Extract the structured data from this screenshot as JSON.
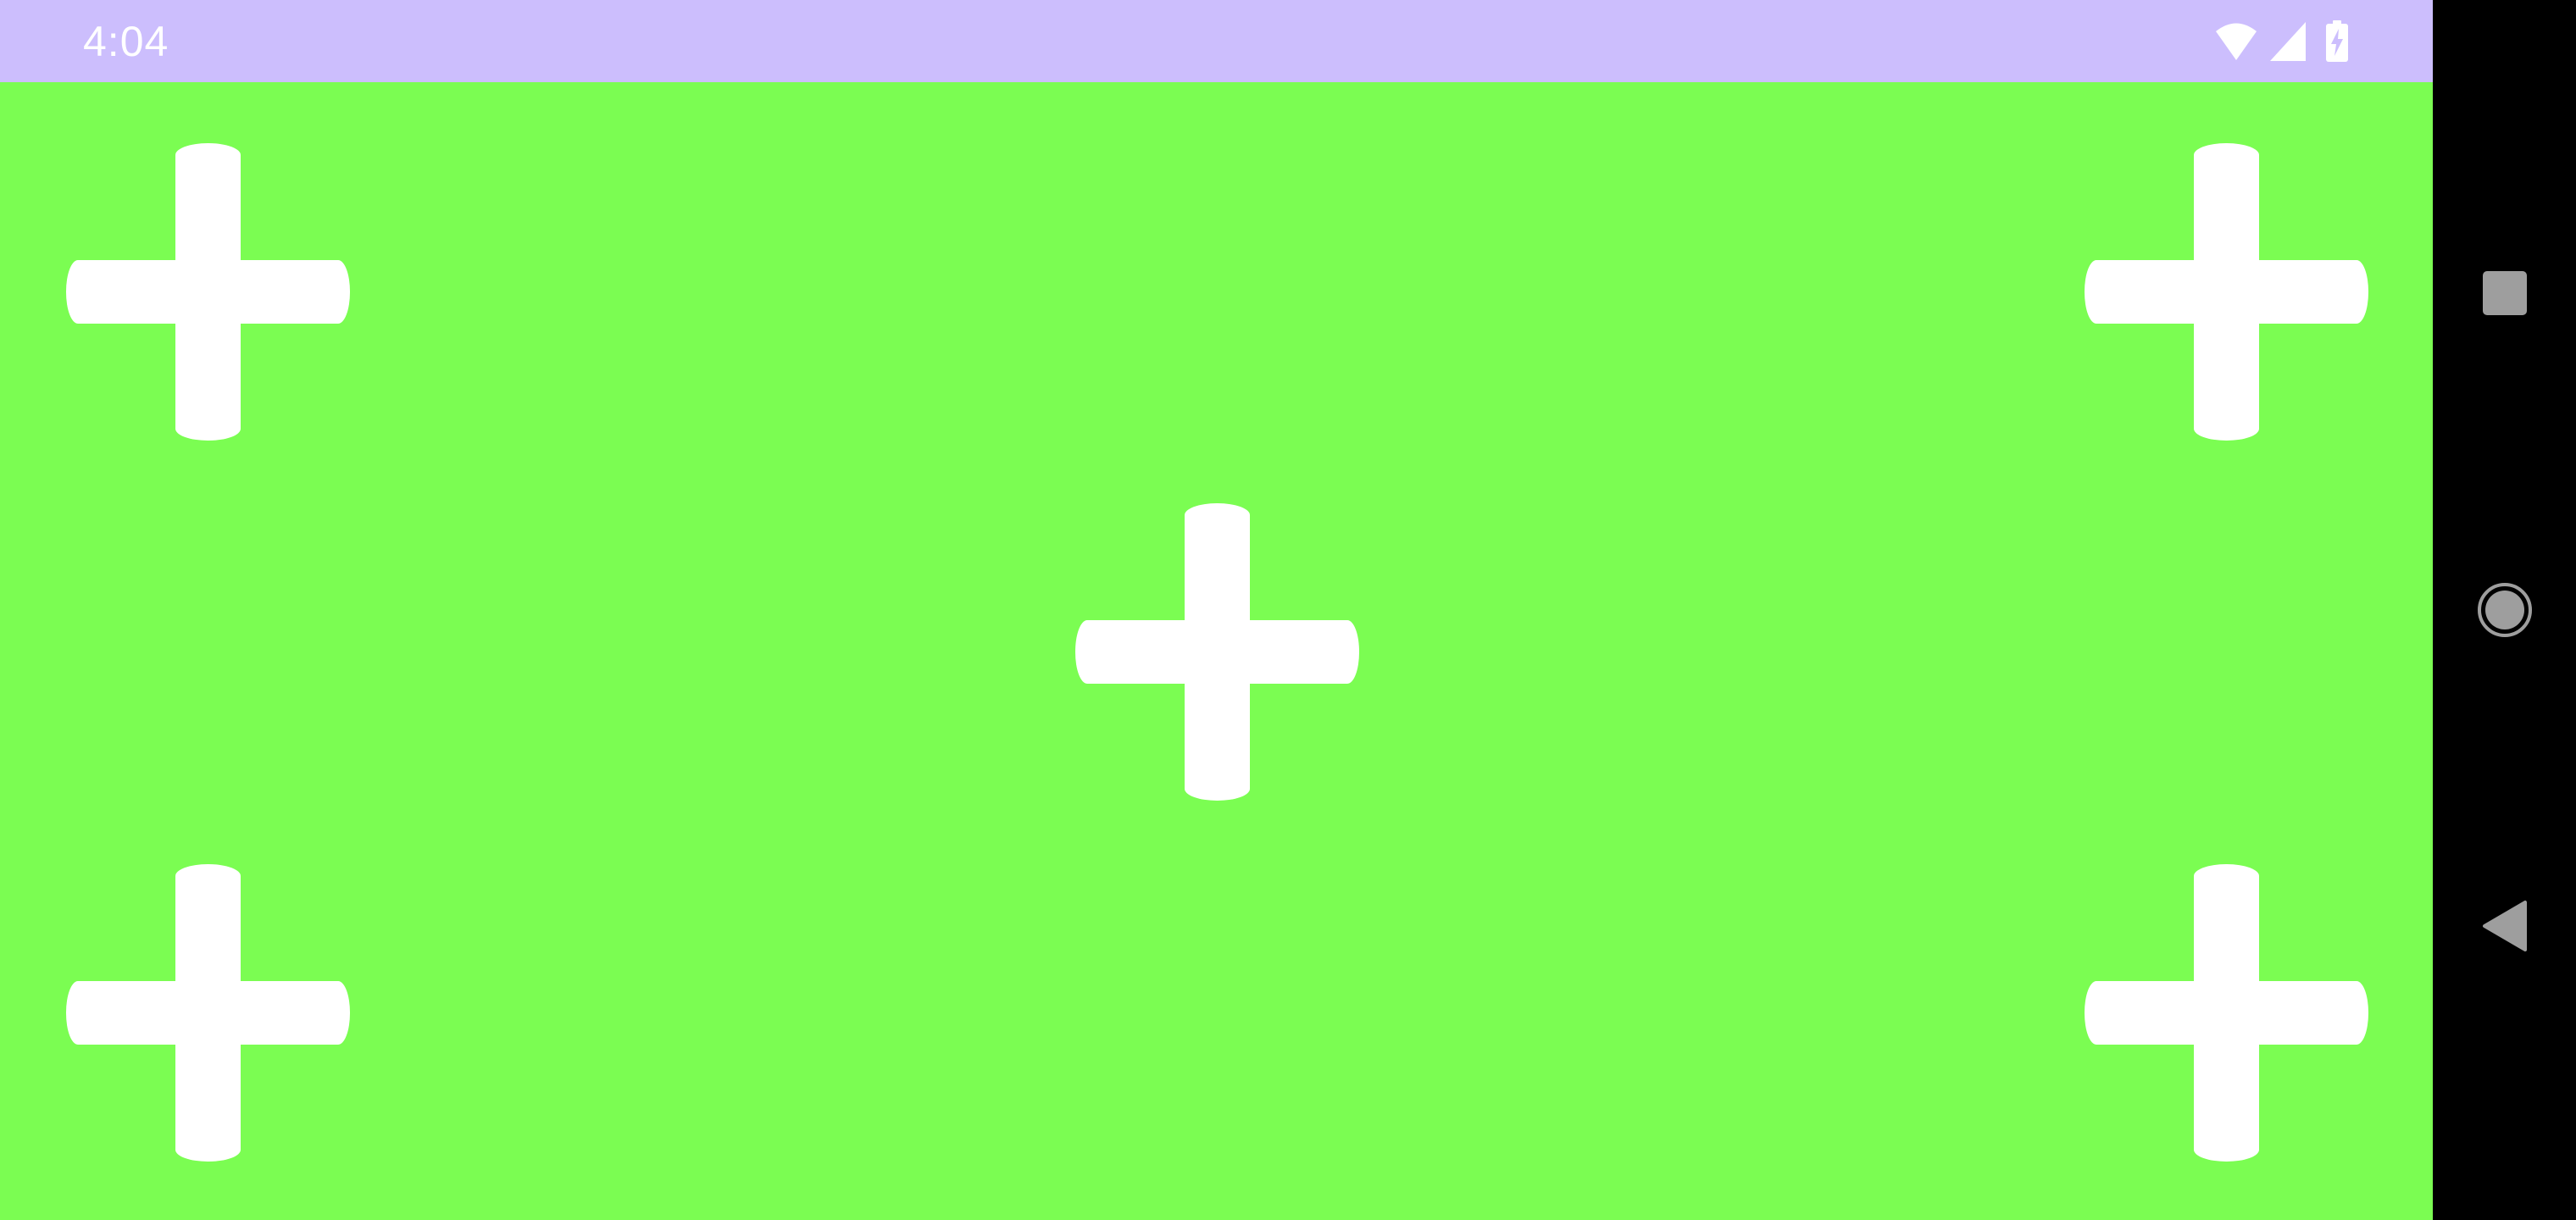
{
  "status_bar": {
    "time": "4:04",
    "icons": [
      "wifi-icon",
      "signal-icon",
      "battery-charging-icon"
    ],
    "background_color": "#CCBEFD"
  },
  "content": {
    "background_color": "#7BFD52",
    "crosshairs": [
      {
        "name": "crosshair-top-left",
        "icon": "plus-icon"
      },
      {
        "name": "crosshair-top-right",
        "icon": "plus-icon"
      },
      {
        "name": "crosshair-center",
        "icon": "plus-icon"
      },
      {
        "name": "crosshair-bottom-left",
        "icon": "plus-icon"
      },
      {
        "name": "crosshair-bottom-right",
        "icon": "plus-icon"
      }
    ],
    "crosshair_color": "#FFFFFF"
  },
  "navigation_bar": {
    "buttons": [
      "recents-icon",
      "home-icon",
      "back-icon"
    ],
    "background_color": "#000000",
    "icon_color": "#9E9E9E"
  }
}
